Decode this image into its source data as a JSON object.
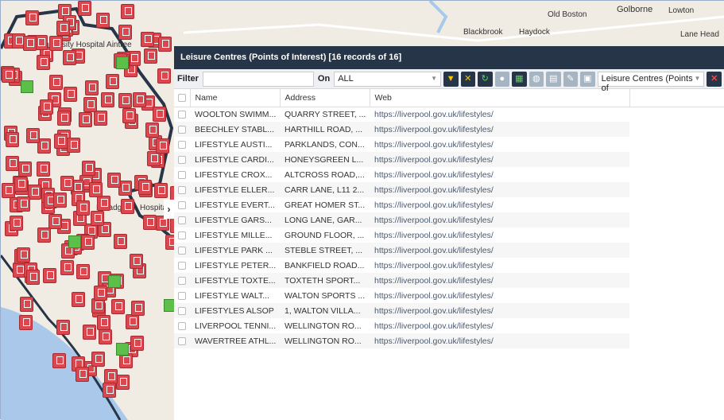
{
  "map": {
    "labels": [
      "Aintree",
      "Golborne",
      "Lowton",
      "Old Boston",
      "Blackbrook",
      "Haydock",
      "Lane Head",
      "University Hospital Aintree",
      "Broadgreen Hospital"
    ]
  },
  "panel": {
    "title": "Leisure Centres (Points of Interest) [16 records of 16]",
    "filter_label": "Filter",
    "filter_value": "",
    "on_label": "On",
    "on_value": "ALL",
    "layer_select": "Leisure Centres (Points of",
    "columns": [
      "Name",
      "Address",
      "Web"
    ],
    "rows": [
      [
        "WOOLTON SWIMM...",
        "QUARRY STREET, ...",
        "https://liverpool.gov.uk/lifestyles/"
      ],
      [
        "BEECHLEY STABL...",
        "HARTHILL ROAD, ...",
        "https://liverpool.gov.uk/lifestyles/"
      ],
      [
        "LIFESTYLE AUSTI...",
        "PARKLANDS, CON...",
        "https://liverpool.gov.uk/lifestyles/"
      ],
      [
        "LIFESTYLE CARDI...",
        "HONEYSGREEN L...",
        "https://liverpool.gov.uk/lifestyles/"
      ],
      [
        "LIFESTYLE CROX...",
        "ALTCROSS ROAD,...",
        "https://liverpool.gov.uk/lifestyles/"
      ],
      [
        "LIFESTYLE ELLER...",
        "CARR LANE, L11 2...",
        "https://liverpool.gov.uk/lifestyles/"
      ],
      [
        "LIFESTYLE EVERT...",
        "GREAT HOMER ST...",
        "https://liverpool.gov.uk/lifestyles/"
      ],
      [
        "LIFESTYLE GARS...",
        "LONG LANE, GAR...",
        "https://liverpool.gov.uk/lifestyles/"
      ],
      [
        "LIFESTYLE MILLE...",
        "GROUND FLOOR, ...",
        "https://liverpool.gov.uk/lifestyles/"
      ],
      [
        "LIFESTYLE PARK ...",
        "STEBLE STREET, ...",
        "https://liverpool.gov.uk/lifestyles/"
      ],
      [
        "LIFESTYLE PETER...",
        "BANKFIELD ROAD...",
        "https://liverpool.gov.uk/lifestyles/"
      ],
      [
        "LIFESTYLE TOXTE...",
        "TOXTETH SPORT...",
        "https://liverpool.gov.uk/lifestyles/"
      ],
      [
        "LIFESTYLE WALT...",
        "WALTON SPORTS ...",
        "https://liverpool.gov.uk/lifestyles/"
      ],
      [
        "LIFESTYLES ALSOP",
        "1, WALTON VILLA...",
        "https://liverpool.gov.uk/lifestyles/"
      ],
      [
        "LIVERPOOL TENNI...",
        "WELLINGTON RO...",
        "https://liverpool.gov.uk/lifestyles/"
      ],
      [
        "WAVERTREE ATHL...",
        "WELLINGTON RO...",
        "https://liverpool.gov.uk/lifestyles/"
      ]
    ]
  },
  "colors": {
    "header": "#263548",
    "marker": "#d9474f",
    "boundary": "#263548"
  }
}
